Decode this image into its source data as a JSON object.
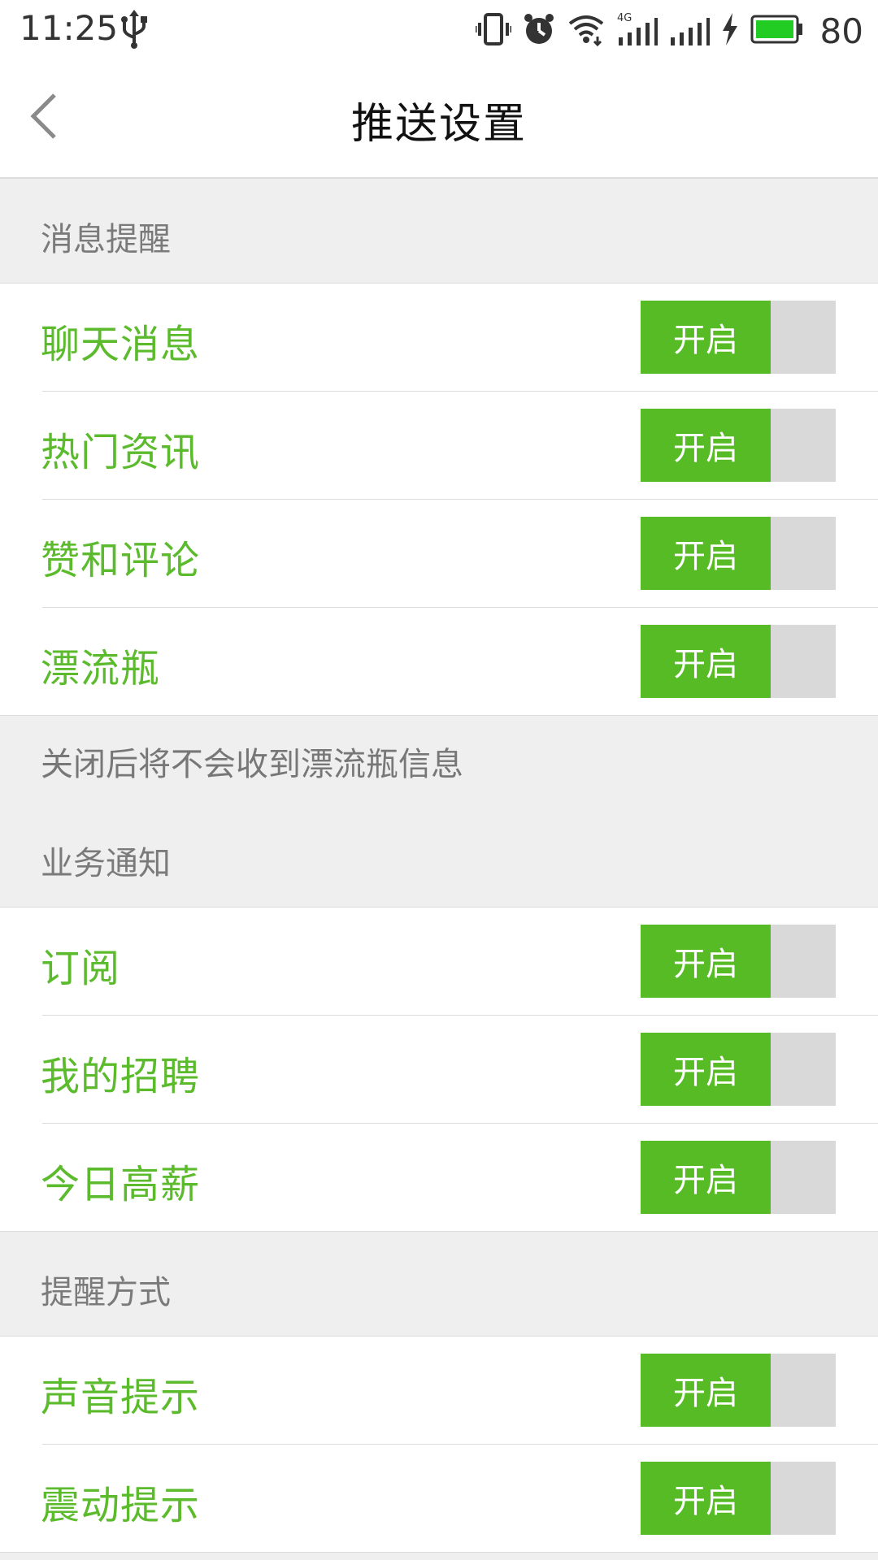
{
  "status_bar": {
    "time": "11:25",
    "battery_level": "80",
    "icons": [
      "usb-icon",
      "vibrate-icon",
      "alarm-icon",
      "wifi-icon",
      "signal-4g-icon",
      "signal-icon",
      "charging-icon",
      "battery-icon"
    ],
    "battery_color": "#22cc22"
  },
  "header": {
    "title": "推送设置"
  },
  "colors": {
    "accent": "#56bb24",
    "label_green": "#5bbb2c",
    "toggle_off": "#d9d9d9",
    "background": "#efefef"
  },
  "sections": {
    "message": {
      "title": "消息提醒",
      "items": [
        {
          "label": "聊天消息",
          "toggle": "开启"
        },
        {
          "label": "热门资讯",
          "toggle": "开启"
        },
        {
          "label": "赞和评论",
          "toggle": "开启"
        },
        {
          "label": "漂流瓶",
          "toggle": "开启"
        }
      ],
      "hint": "关闭后将不会收到漂流瓶信息"
    },
    "business": {
      "title": "业务通知",
      "items": [
        {
          "label": "订阅",
          "toggle": "开启"
        },
        {
          "label": "我的招聘",
          "toggle": "开启"
        },
        {
          "label": "今日高薪",
          "toggle": "开启"
        }
      ]
    },
    "method": {
      "title": "提醒方式",
      "items": [
        {
          "label": "声音提示",
          "toggle": "开启"
        },
        {
          "label": "震动提示",
          "toggle": "开启"
        }
      ]
    }
  }
}
